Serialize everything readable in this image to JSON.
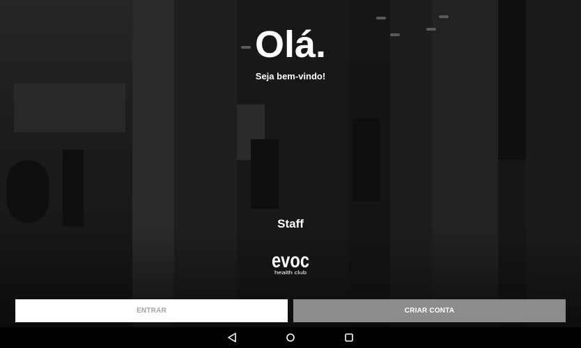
{
  "welcome": {
    "greeting": "Olá.",
    "subtitle": "Seja bem-vindo!"
  },
  "staff_label": "Staff",
  "logo": {
    "brand": "evoc",
    "tagline": "health club"
  },
  "actions": {
    "enter_label": "ENTRAR",
    "create_account_label": "CRIAR CONTA"
  },
  "navbar": {
    "back_icon": "back-triangle-icon",
    "home_icon": "home-circle-icon",
    "recents_icon": "recents-square-icon"
  },
  "colors": {
    "enter_button_bg": "#ffffff",
    "enter_button_text": "#a3a3a3",
    "create_button_bg": "#8c8c8c",
    "create_button_text": "#ffffff",
    "text": "#ffffff",
    "navbar_bg": "#000000"
  }
}
